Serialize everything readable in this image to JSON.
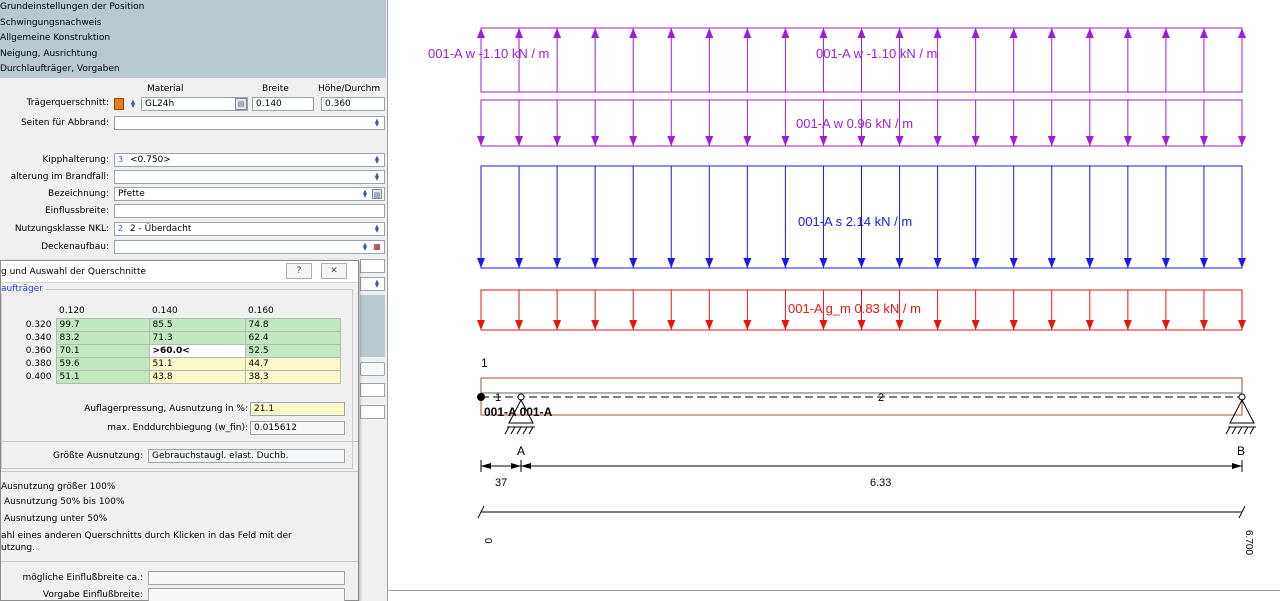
{
  "navigation": {
    "items": [
      "Grundeinstellungen der Position",
      "Schwingungsnachweis",
      "Allgemeine Konstruktion",
      "Neigung, Ausrichtung",
      "Durchlaufträger, Vorgaben"
    ]
  },
  "form": {
    "column_headers": {
      "material": "Material",
      "breite": "Breite",
      "hoehe": "Höhe/Durchm"
    },
    "traegerquerschnitt": {
      "label": "Trägerquerschnitt:",
      "material": "GL24h",
      "breite": "0.140",
      "hoehe": "0.360"
    },
    "seiten_abbrand": {
      "label": "Seiten für Abbrand:",
      "value": ""
    },
    "kipphalterung": {
      "label": "Kipphalterung:",
      "prefix": "3",
      "value": "<0.750>"
    },
    "halterung_brandfall": {
      "label": "alterung im Brandfall:",
      "value": ""
    },
    "bezeichnung": {
      "label": "Bezeichnung:",
      "value": "Pfette"
    },
    "einflussbreite": {
      "label": "Einflussbreite:",
      "value": ""
    },
    "nutzungsklasse": {
      "label": "Nutzungsklasse NKL:",
      "prefix": "2",
      "value": "2 - Überdacht"
    },
    "deckenaufbau": {
      "label": "Deckenaufbau:",
      "value": ""
    }
  },
  "dialog": {
    "title": "g und Auswahl der Querschnitte",
    "help_button": "?",
    "close_button": "✕",
    "group_title": "aufträger",
    "column_headers": [
      "0.120",
      "0.140",
      "0.160"
    ],
    "rows": [
      {
        "h": "0.320",
        "cells": [
          {
            "v": "99.7",
            "c": "green"
          },
          {
            "v": "85.5",
            "c": "green"
          },
          {
            "v": "74.8",
            "c": "green"
          }
        ]
      },
      {
        "h": "0.340",
        "cells": [
          {
            "v": "83.2",
            "c": "green"
          },
          {
            "v": "71.3",
            "c": "green"
          },
          {
            "v": "62.4",
            "c": "green"
          }
        ]
      },
      {
        "h": "0.360",
        "cells": [
          {
            "v": "70.1",
            "c": "green"
          },
          {
            "v": ">60.0<",
            "c": "white",
            "bold": true
          },
          {
            "v": "52.5",
            "c": "green"
          }
        ]
      },
      {
        "h": "0.380",
        "cells": [
          {
            "v": "59.6",
            "c": "green"
          },
          {
            "v": "51.1",
            "c": "yellow"
          },
          {
            "v": "44.7",
            "c": "yellow"
          }
        ]
      },
      {
        "h": "0.400",
        "cells": [
          {
            "v": "51.1",
            "c": "green"
          },
          {
            "v": "43.8",
            "c": "yellow"
          },
          {
            "v": "38.3",
            "c": "yellow"
          }
        ]
      }
    ],
    "auflagerpressung": {
      "label": "Auflagerpressung, Ausnutzung in %:",
      "value": "21.1"
    },
    "enddurchbiegung": {
      "label": "max. Enddurchbiegung (w_fin):",
      "value": "0.015612"
    },
    "groesste_ausnutzung": {
      "label": "Größte Ausnutzung:",
      "value": "Gebrauchstaugl. elast. Duchb."
    },
    "legend": [
      "Ausnutzung größer 100%",
      "Ausnutzung 50% bis 100%",
      "Ausnutzung unter 50%"
    ],
    "hint_line1": "ahl eines anderen Querschnitts durch Klicken in das Feld mit der",
    "hint_line2": "utzung.",
    "moegliche_einflussbreite": {
      "label": "mögliche Einflußbreite ca.:",
      "value": ""
    },
    "vorgabe_einflussbreite": {
      "label": "Vorgabe Einflußbreite:",
      "value": ""
    }
  },
  "drawing": {
    "colors": {
      "purple": "#9b1fd6",
      "blue": "#1a1ae6",
      "red": "#e81414",
      "beam": "#a0522d",
      "black": "#000000"
    },
    "loads": [
      {
        "label": "001-A w -1.10 kN / m",
        "label2": "001-A w -1.10 kN / m",
        "color": "purple",
        "direction": "up"
      },
      {
        "label": "001-A w 0.96 kN / m",
        "color": "purple",
        "direction": "down"
      },
      {
        "label": "001-A s 2.14 kN / m",
        "color": "blue",
        "direction": "down"
      },
      {
        "label": "001-A g_m 0.83 kN / m",
        "color": "red",
        "direction": "down"
      }
    ],
    "node_label_top": "1",
    "beam_label_1": "1",
    "beam_label_2": "2",
    "beam_load_tags": "001-A 001-A",
    "support_a": "A",
    "support_b": "B",
    "dim_left": "37",
    "dim_main": "6.33",
    "coord_start": "0",
    "coord_end": "6.700"
  }
}
